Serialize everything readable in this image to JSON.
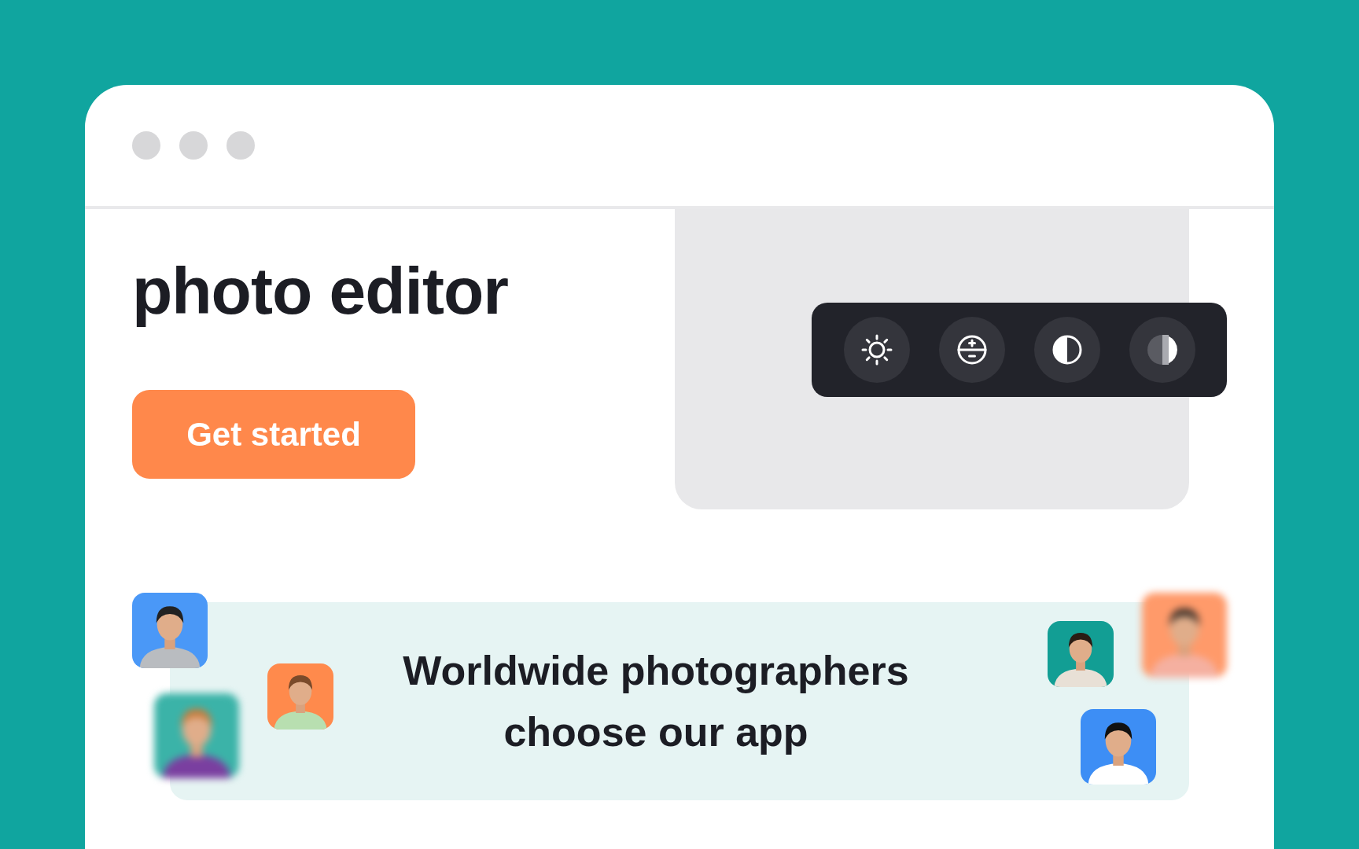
{
  "hero": {
    "heading_lines": [
      "photo editor"
    ],
    "cta": "Get started"
  },
  "banner": {
    "text": "Worldwide photographers choose our app"
  }
}
